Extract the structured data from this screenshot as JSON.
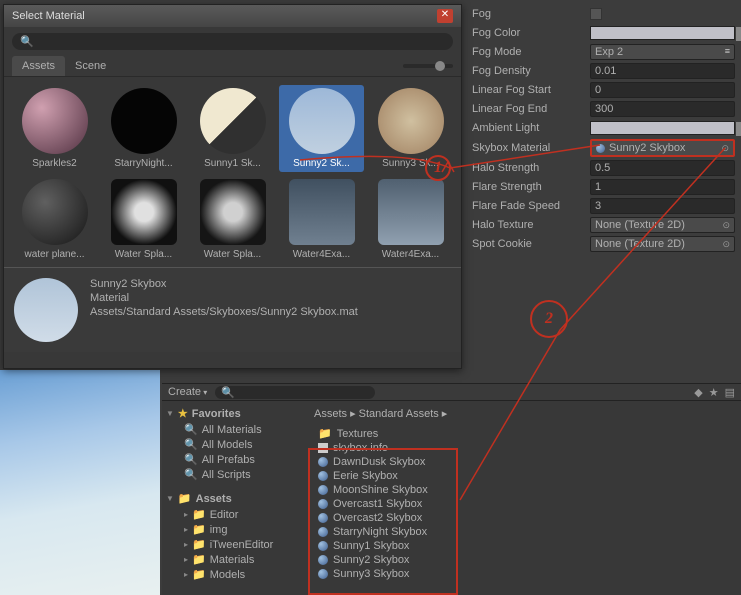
{
  "picker": {
    "title": "Select Material",
    "search_value": "",
    "tabs": {
      "assets": "Assets",
      "scene": "Scene"
    },
    "materials_row1": [
      {
        "label": "Sparkles2",
        "cls": "t-sparkles"
      },
      {
        "label": "StarryNight...",
        "cls": "t-starry"
      },
      {
        "label": "Sunny1 Sk...",
        "cls": "t-sunny1"
      },
      {
        "label": "Sunny2 Sk...",
        "cls": "t-sunny2",
        "selected": true
      },
      {
        "label": "Sunny3 Sk...",
        "cls": "t-sunny3"
      }
    ],
    "materials_row2": [
      {
        "label": "water plane...",
        "cls": "t-water1"
      },
      {
        "label": "Water Spla...",
        "cls": "t-water2"
      },
      {
        "label": "Water Spla...",
        "cls": "t-water3"
      },
      {
        "label": "Water4Exa...",
        "cls": "t-water4"
      },
      {
        "label": "Water4Exa...",
        "cls": "t-water5"
      }
    ],
    "preview": {
      "name": "Sunny2 Skybox",
      "type": "Material",
      "path": "Assets/Standard Assets/Skyboxes/Sunny2 Skybox.mat"
    }
  },
  "inspector": {
    "fog": "Fog",
    "fog_color": "Fog Color",
    "fog_mode": "Fog Mode",
    "fog_mode_val": "Exp 2",
    "fog_density": "Fog Density",
    "fog_density_val": "0.01",
    "lin_fog_start": "Linear Fog Start",
    "lin_fog_start_val": "0",
    "lin_fog_end": "Linear Fog End",
    "lin_fog_end_val": "300",
    "ambient": "Ambient Light",
    "skybox_mat": "Skybox Material",
    "skybox_mat_val": "Sunny2 Skybox",
    "halo_str": "Halo Strength",
    "halo_str_val": "0.5",
    "flare_str": "Flare Strength",
    "flare_str_val": "1",
    "flare_fade": "Flare Fade Speed",
    "flare_fade_val": "3",
    "halo_tex": "Halo Texture",
    "halo_tex_val": "None (Texture 2D)",
    "spot_cookie": "Spot Cookie",
    "spot_cookie_val": "None (Texture 2D)"
  },
  "project": {
    "create": "Create",
    "breadcrumb": "Assets ▸ Standard Assets ▸",
    "favorites": "Favorites",
    "fav_items": [
      "All Materials",
      "All Models",
      "All Prefabs",
      "All Scripts"
    ],
    "assets": "Assets",
    "asset_folders": [
      "Editor",
      "img",
      "iTweenEditor",
      "Materials",
      "Models"
    ],
    "files_top": [
      {
        "label": "Textures",
        "type": "folder"
      },
      {
        "label": "skybox info",
        "type": "text"
      }
    ],
    "skyboxes": [
      "DawnDusk Skybox",
      "Eerie Skybox",
      "MoonShine Skybox",
      "Overcast1 Skybox",
      "Overcast2 Skybox",
      "StarryNight Skybox",
      "Sunny1 Skybox",
      "Sunny2 Skybox",
      "Sunny3 Skybox"
    ]
  },
  "annot": {
    "a1": "1",
    "a2": "2"
  }
}
